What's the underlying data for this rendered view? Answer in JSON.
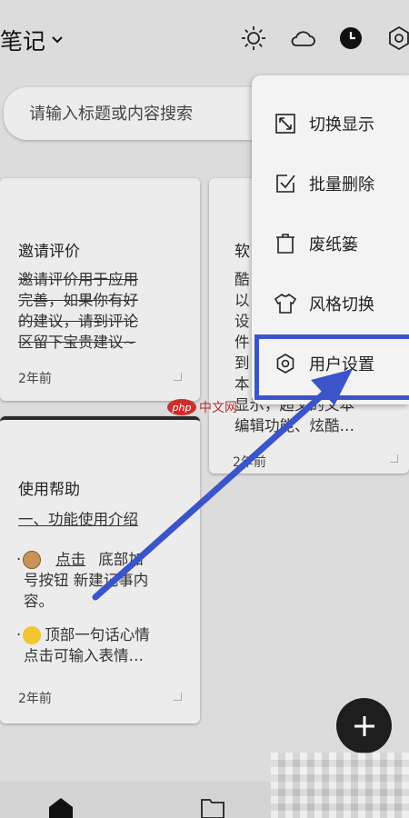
{
  "header": {
    "title": "笔记",
    "icons": [
      "sun-icon",
      "cloud-icon",
      "clock-icon",
      "settings-icon"
    ]
  },
  "search": {
    "placeholder": "请输入标题或内容搜索"
  },
  "notes": [
    {
      "title": "邀请评价",
      "lines": [
        "邀请评价用于应用",
        "完善，如果你有好",
        "的建议，请到评论",
        "区留下宝贵建议~"
      ],
      "date": "2年前"
    },
    {
      "title": "软",
      "lines": [
        "酷",
        "以",
        "设",
        "件",
        "到",
        "本",
        "显示，超文的文本",
        "编辑功能、炫酷…"
      ],
      "date": "2年前"
    },
    {
      "title": "使用帮助",
      "line1": "一、功能使用介绍",
      "p1_pre": "点击",
      "p1_post": "底部加",
      "p1_l2": "号按钮 新建记事内",
      "p1_l3": "容。",
      "p2_l1": "顶部一句话心情",
      "p2_l2": "点击可输入表情…",
      "date": "2年前"
    }
  ],
  "menu": {
    "items": [
      {
        "label": "切换显示",
        "icon": "switch-display-icon"
      },
      {
        "label": "批量删除",
        "icon": "batch-delete-icon"
      },
      {
        "label": "废纸篓",
        "icon": "trash-icon"
      },
      {
        "label": "风格切换",
        "icon": "shirt-icon"
      },
      {
        "label": "用户设置",
        "icon": "gear-icon"
      }
    ]
  },
  "watermark": {
    "logo": "php",
    "text": "中文网"
  },
  "colors": {
    "annotation": "#3b54c9",
    "fab": "#1e1e1e"
  }
}
